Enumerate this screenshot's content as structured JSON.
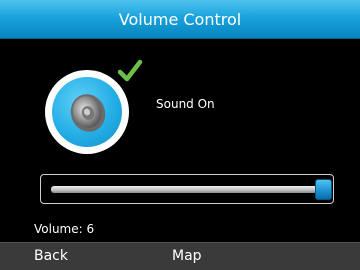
{
  "title": "Volume Control",
  "sound_status": {
    "label": "Sound On",
    "icon": "speaker-icon",
    "indicator_icon": "checkmark-icon"
  },
  "volume": {
    "label": "Volume: 6",
    "value": 6,
    "fraction": 1.0
  },
  "softkeys": {
    "left": "Back",
    "center": "Map"
  },
  "colors": {
    "accent": "#1aa3dc",
    "check": "#6cc04a",
    "softkey_bar": "#3a3a3a"
  }
}
